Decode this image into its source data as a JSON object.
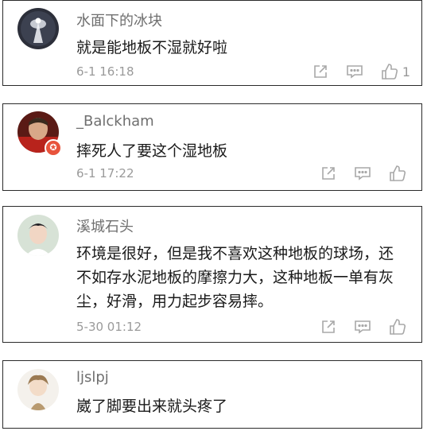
{
  "comments": [
    {
      "username": "水面下的冰块",
      "text": "就是能地板不湿就好啦",
      "time": "6-1 16:18",
      "likes": "1",
      "action_icons": [
        "share-icon",
        "reply-icon",
        "thumbs-up-icon"
      ]
    },
    {
      "username": "_Balckham",
      "text": "摔死人了要这个湿地板",
      "time": "6-1 17:22",
      "likes": "",
      "badge_glyph": "✪",
      "action_icons": [
        "share-icon",
        "reply-icon",
        "thumbs-up-icon"
      ]
    },
    {
      "username": "溪城石头",
      "text": "环境是很好，但是我不喜欢这种地板的球场，还不如存水泥地板的摩擦力大，这种地板一单有灰尘，好滑，用力起步容易摔。",
      "time": "5-30 01:12",
      "likes": "",
      "action_icons": [
        "share-icon",
        "reply-icon",
        "thumbs-up-icon"
      ]
    },
    {
      "username": "ljslpj",
      "text": "崴了脚要出来就头疼了",
      "time": "",
      "likes": ""
    }
  ],
  "colors": {
    "border": "#2b2b2b",
    "username": "#6f6f6f",
    "meta": "#9a9a9a",
    "icon": "#a8a8a8",
    "badge": "#e8533c"
  }
}
